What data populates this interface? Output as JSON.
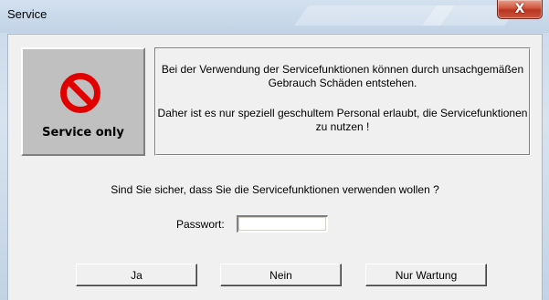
{
  "window": {
    "title": "Service",
    "close_glyph": "X"
  },
  "banner": {
    "icon": "no-entry-icon",
    "label": "Service only",
    "icon_color": "#e00000"
  },
  "message": {
    "line1": "Bei der Verwendung der Servicefunktionen können durch unsachgemäßen Gebrauch Schäden entstehen.",
    "line2": "Daher ist es nur speziell geschultem Personal erlaubt, die Servicefunktionen zu nutzen !"
  },
  "question": "Sind Sie sicher, dass Sie die Servicefunktionen verwenden wollen ?",
  "password": {
    "label": "Passwort:",
    "value": ""
  },
  "buttons": {
    "yes": "Ja",
    "no": "Nein",
    "maintenance": "Nur Wartung"
  }
}
